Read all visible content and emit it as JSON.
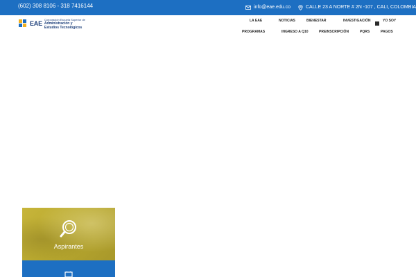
{
  "topbar": {
    "phone": "(602) 308 8106 - 318 7416144",
    "email": "info@eae.edu.co",
    "address": "CALLE 23 A NORTE # 2N -107 , CALI, COLOMBIA",
    "email_icon": "envelope-icon",
    "address_icon": "location-pin-icon",
    "background": "#1d6fc2"
  },
  "logo": {
    "mark": "EAE",
    "line1": "Corporación Escuela Superior de",
    "line2": "Administración y",
    "line3": "Estudios Tecnológicos"
  },
  "nav": {
    "row1": [
      "LA EAE",
      "NOTICIAS",
      "BIENESTAR",
      "INVESTIGACIÓN",
      "YO SOY"
    ],
    "row2": [
      "PROGRAMAS",
      "INGRESO A Q10",
      "PREINSCRIPCIÓN",
      "PQRS",
      "PAGOS"
    ],
    "menu_icon": "grid-menu-icon"
  },
  "cards": {
    "aspirantes": {
      "label": "Aspirantes",
      "icon": "magnifier-icon",
      "color": "#c2b032"
    },
    "second": {
      "icon": "document-icon",
      "color": "#1d6fc2"
    }
  }
}
